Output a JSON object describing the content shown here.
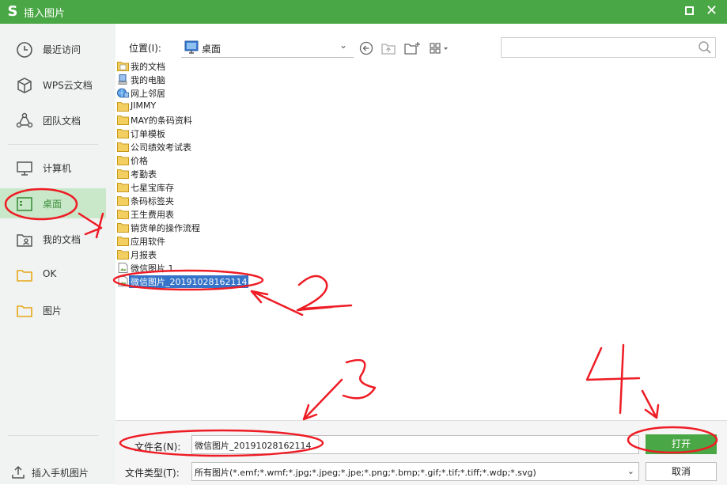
{
  "window": {
    "title": "插入图片",
    "logo": "S"
  },
  "sidebar": {
    "items": [
      {
        "label": "最近访问",
        "icon": "clock-icon"
      },
      {
        "label": "WPS云文档",
        "icon": "cube-icon"
      },
      {
        "label": "团队文档",
        "icon": "team-icon"
      },
      {
        "label": "计算机",
        "icon": "monitor-icon"
      },
      {
        "label": "桌面",
        "icon": "desktop-icon",
        "active": true
      },
      {
        "label": "我的文档",
        "icon": "user-folder-icon"
      },
      {
        "label": "OK",
        "icon": "folder-icon"
      },
      {
        "label": "图片",
        "icon": "folder-icon"
      }
    ],
    "bottom_label": "插入手机图片"
  },
  "toolbar": {
    "location_label": "位置(I):",
    "location_value": "桌面"
  },
  "search": {
    "placeholder": ""
  },
  "files": [
    {
      "name": "我的文档",
      "type": "special"
    },
    {
      "name": "我的电脑",
      "type": "computer"
    },
    {
      "name": "网上邻居",
      "type": "network"
    },
    {
      "name": "JIMMY",
      "type": "folder"
    },
    {
      "name": "MAY的条码资料",
      "type": "folder"
    },
    {
      "name": "订单模板",
      "type": "folder"
    },
    {
      "name": "公司绩效考试表",
      "type": "folder"
    },
    {
      "name": "价格",
      "type": "folder"
    },
    {
      "name": "考勤表",
      "type": "folder"
    },
    {
      "name": "七星宝库存",
      "type": "folder"
    },
    {
      "name": "条码标签夹",
      "type": "folder"
    },
    {
      "name": "王生费用表",
      "type": "folder"
    },
    {
      "name": "销货单的操作流程",
      "type": "folder"
    },
    {
      "name": "应用软件",
      "type": "folder"
    },
    {
      "name": "月报表",
      "type": "folder"
    },
    {
      "name": "微信图片 1",
      "type": "image"
    },
    {
      "name": "微信图片_20191028162114",
      "type": "image",
      "selected": true
    }
  ],
  "bottom": {
    "filename_label": "文件名(N):",
    "filename_value": "微信图片_20191028162114",
    "filetype_label": "文件类型(T):",
    "filetype_value": "所有图片(*.emf;*.wmf;*.jpg;*.jpeg;*.jpe;*.png;*.bmp;*.gif;*.tif;*.tiff;*.wdp;*.svg)",
    "open_label": "打开",
    "cancel_label": "取消"
  },
  "colors": {
    "accent": "#4aa745",
    "selection": "#3574c8",
    "annotation": "#ee1c25"
  }
}
